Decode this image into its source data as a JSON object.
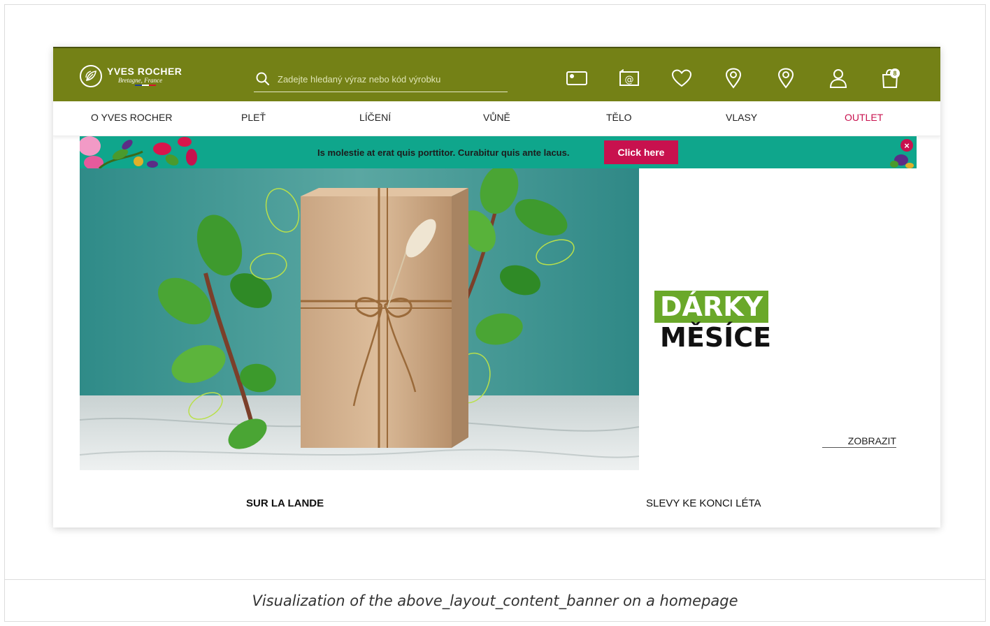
{
  "header": {
    "logo_name": "YVES ROCHER",
    "logo_tagline": "Bretagne, France",
    "search_placeholder": "Zadejte hledaný výraz nebo kód výrobku",
    "cart_count": "8",
    "bg_color": "#748116",
    "icons": [
      "gift-card-icon",
      "newsletter-icon",
      "wishlist-icon",
      "store-locator-icon",
      "location-icon",
      "account-icon",
      "cart-icon"
    ]
  },
  "nav": {
    "items": [
      "O YVES ROCHER",
      "PLEŤ",
      "LÍČENÍ",
      "VŮNĚ",
      "TĚLO",
      "VLASY",
      "OUTLET"
    ],
    "outlet_color": "#c8114e"
  },
  "promo": {
    "text": "Is molestie at erat quis porttitor. Curabitur quis ante lacus.",
    "button_label": "Click here",
    "close_label": "×",
    "bg_color": "#0fa68c"
  },
  "hero": {
    "title_line1": "DÁRKY",
    "title_line2": "MĚSÍCE",
    "link_label": "ZOBRAZIT",
    "highlight_color": "#6aa82a"
  },
  "tabs": [
    {
      "label": "SUR LA LANDE",
      "active": true
    },
    {
      "label": "SLEVY KE KONCI LÉTA",
      "active": false
    }
  ],
  "caption": "Visualization of the above_layout_content_banner on a homepage"
}
